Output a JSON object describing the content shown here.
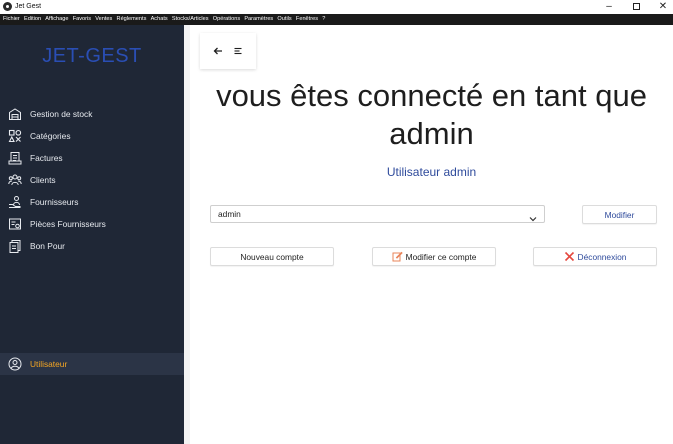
{
  "window": {
    "title": "Jet Gest",
    "minimize": "–",
    "close": "✕"
  },
  "menu": [
    "Fichier",
    "Edition",
    "Affichage",
    "Favoris",
    "Ventes",
    "Réglements",
    "Achats",
    "Stocks/Articles",
    "Opérations",
    "Paramètres",
    "Outils",
    "Fenêtres",
    "?"
  ],
  "sidebar": {
    "brand": "JET-GEST",
    "items": [
      {
        "label": "Gestion de stock",
        "icon": "warehouse-icon"
      },
      {
        "label": "Catégories",
        "icon": "categories-icon"
      },
      {
        "label": "Factures",
        "icon": "invoice-icon"
      },
      {
        "label": "Clients",
        "icon": "clients-icon"
      },
      {
        "label": "Fournisseurs",
        "icon": "supplier-icon"
      },
      {
        "label": "Pièces Fournisseurs",
        "icon": "supplier-docs-icon"
      },
      {
        "label": "Bon Pour",
        "icon": "voucher-icon"
      }
    ],
    "user": {
      "label": "Utilisateur",
      "icon": "user-icon",
      "color": "#f5a623"
    }
  },
  "main": {
    "heading": "vous êtes connecté en tant que admin",
    "subheading": "Utilisateur admin",
    "user_select": {
      "value": "admin"
    },
    "buttons": {
      "modifier": "Modifier",
      "nouveau_compte": "Nouveau compte",
      "modifier_compte": "Modifier ce compte",
      "deconnexion": "Déconnexion"
    }
  },
  "colors": {
    "sidebar_bg": "#1f2736",
    "brand": "#2a4eb4",
    "accent_blue": "#2f4b9c",
    "active_orange": "#f5a623"
  }
}
